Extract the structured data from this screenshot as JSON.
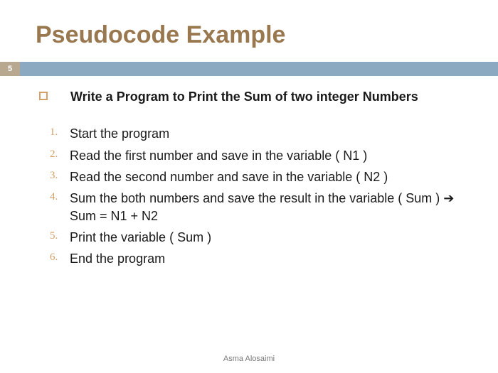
{
  "title": "Pseudocode Example",
  "page_number": "5",
  "heading": "Write a Program to Print the Sum of two integer Numbers",
  "steps": [
    {
      "n": "1.",
      "text": "Start the program"
    },
    {
      "n": "2.",
      "text": "Read the first number and save in  the variable ( N1 )"
    },
    {
      "n": "3.",
      "text": "Read the second number and save in the variable ( N2 )"
    },
    {
      "n": "4.",
      "text": "Sum the both numbers and save the result in the variable ( Sum )     ➔  Sum = N1 + N2"
    },
    {
      "n": "5.",
      "text": "Print the variable ( Sum )"
    },
    {
      "n": "6.",
      "text": "End the program"
    }
  ],
  "footer": "Asma Alosaimi"
}
